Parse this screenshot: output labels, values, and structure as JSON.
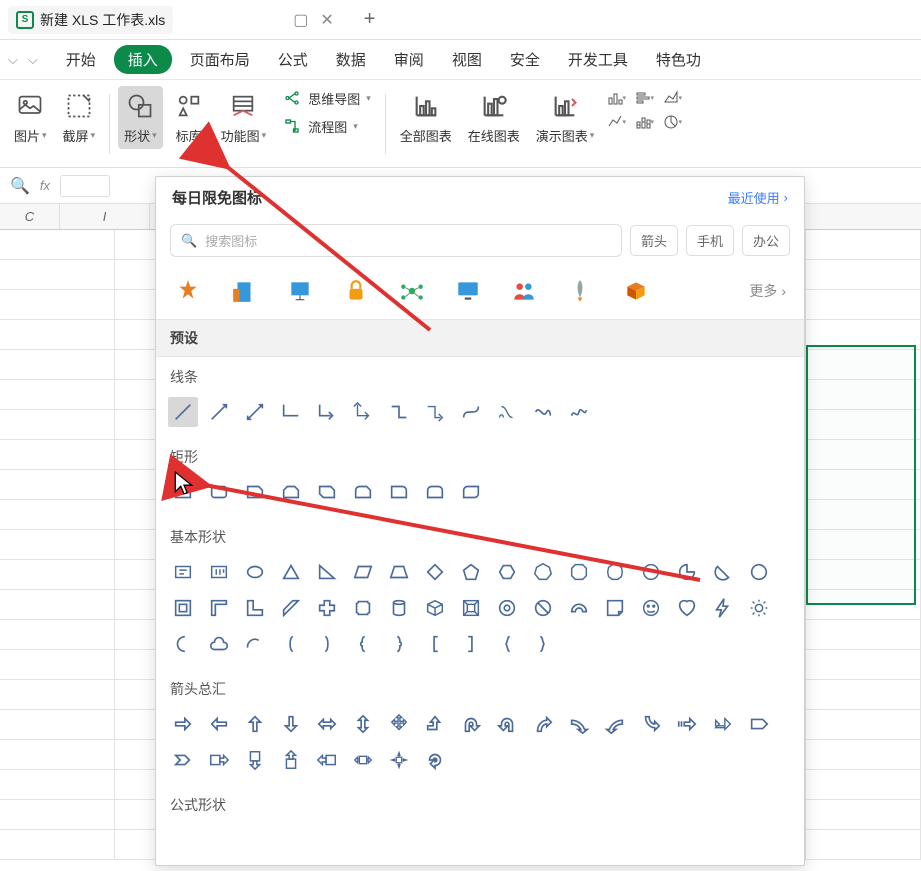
{
  "titlebar": {
    "doc_icon": "S",
    "doc_title": "新建 XLS 工作表.xls"
  },
  "menu": {
    "tabs": [
      "开始",
      "插入",
      "页面布局",
      "公式",
      "数据",
      "审阅",
      "视图",
      "安全",
      "开发工具",
      "特色功"
    ]
  },
  "ribbon": {
    "pic": "图片",
    "screenshot": "截屏",
    "shapes": "形状",
    "iconlib": "标库",
    "funcimg": "功能图",
    "mindmap": "思维导图",
    "flowchart": "流程图",
    "allcharts": "全部图表",
    "onlinecharts": "在线图表",
    "presentcharts": "演示图表"
  },
  "panel": {
    "title": "每日限免图标",
    "recent": "最近使用",
    "search_placeholder": "搜索图标",
    "tags": [
      "箭头",
      "手机",
      "办公"
    ],
    "more": "更多",
    "sections": {
      "preset": "预设",
      "lines": "线条",
      "rects": "矩形",
      "basic": "基本形状",
      "arrows": "箭头总汇",
      "formula": "公式形状"
    }
  },
  "columns": [
    "C",
    "I"
  ]
}
